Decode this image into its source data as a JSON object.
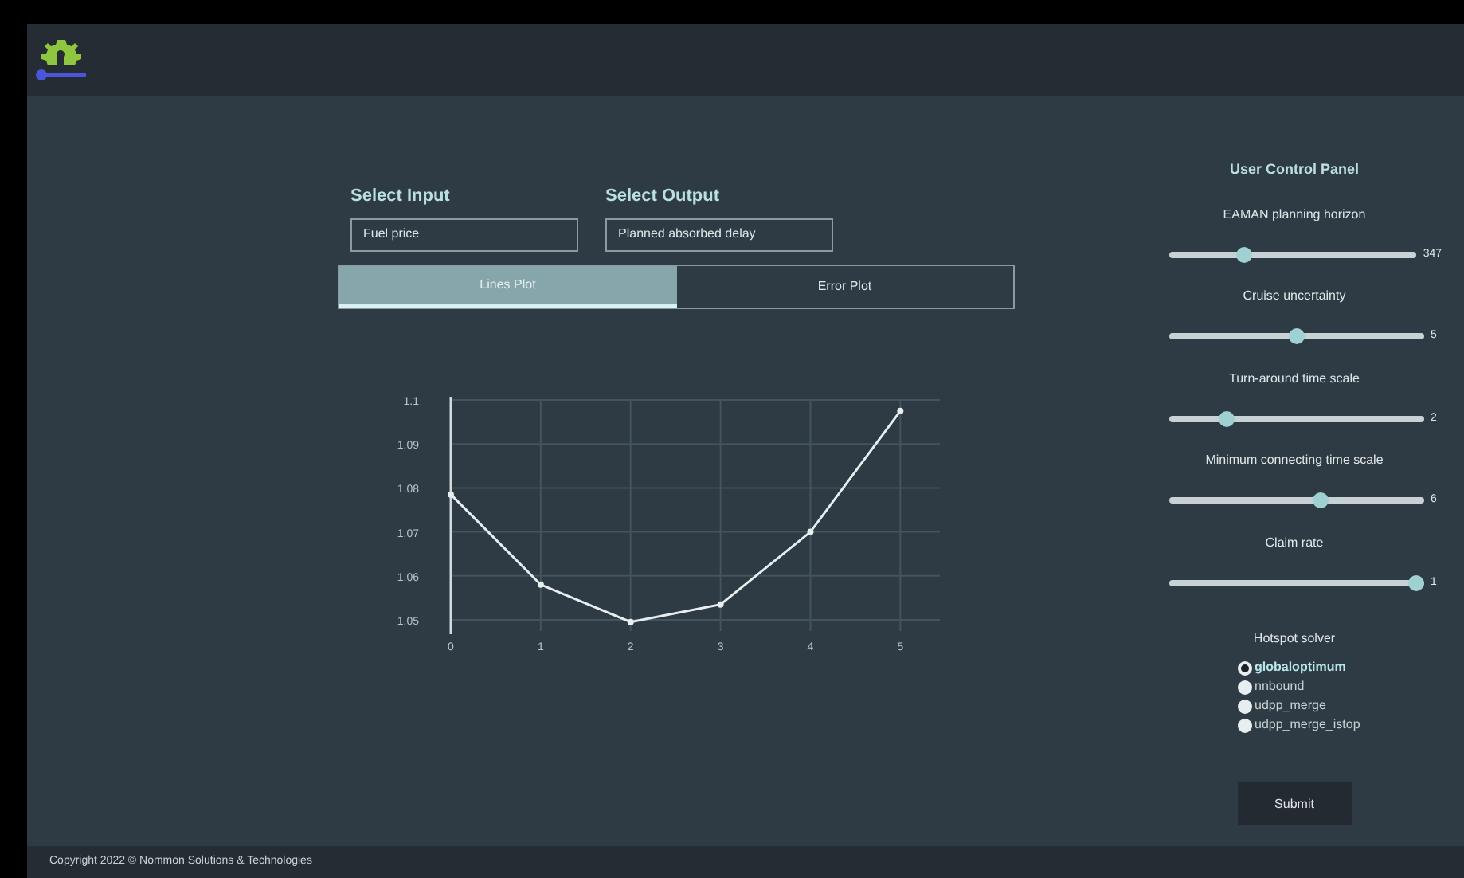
{
  "inputs": [
    {
      "label": "Select Input",
      "value": "Fuel price"
    },
    {
      "label": "Select Output",
      "value": "Planned absorbed delay"
    }
  ],
  "tabs": [
    {
      "label": "Lines Plot",
      "selected": true
    },
    {
      "label": "Error Plot",
      "selected": false
    }
  ],
  "chart": {
    "chart_data": {
      "type": "line",
      "x": [
        0,
        1,
        2,
        3,
        4,
        5
      ],
      "grid": true,
      "series": [
        {
          "color": "#e8eef0",
          "marker": true,
          "values": [
            1.0785,
            1.058,
            1.0495,
            1.0535,
            1.07,
            1.0975
          ]
        }
      ],
      "xticks": [
        0,
        1,
        2,
        3,
        4,
        5
      ],
      "yticks": [
        {
          "value": 1.05,
          "label": "1.05"
        },
        {
          "value": 1.06,
          "label": "1.06"
        },
        {
          "value": 1.07,
          "label": "1.07"
        },
        {
          "value": 1.08,
          "label": "1.08"
        },
        {
          "value": 1.09,
          "label": "1.09"
        },
        {
          "value": 1.1,
          "label": "1.1"
        }
      ],
      "ylim": [
        1.048,
        1.1
      ],
      "xlim": [
        0,
        5.44
      ]
    }
  },
  "panel": {
    "title": "User Control Panel",
    "sliders": [
      {
        "label": "EAMAN planning horizon",
        "level": 0.29,
        "reading": "347"
      },
      {
        "label": "Cruise uncertainty",
        "level": 0.5,
        "reading": "5"
      },
      {
        "label": "Turn-around time scale",
        "level": 0.21,
        "reading": "2"
      },
      {
        "label": "Minimum connecting time scale",
        "level": 0.6,
        "reading": "6"
      },
      {
        "label": "Claim rate",
        "level": 1,
        "reading": "1"
      }
    ],
    "solver": {
      "label": "Hotspot solver",
      "options": [
        {
          "label": "globaloptimum",
          "selected": true
        },
        {
          "label": "nnbound",
          "selected": false
        },
        {
          "label": "udpp_merge",
          "selected": false
        },
        {
          "label": "udpp_merge_istop",
          "selected": false
        }
      ]
    },
    "submit": "Submit"
  },
  "footer": "Copyright 2022 © Nommon Solutions & Technologies"
}
